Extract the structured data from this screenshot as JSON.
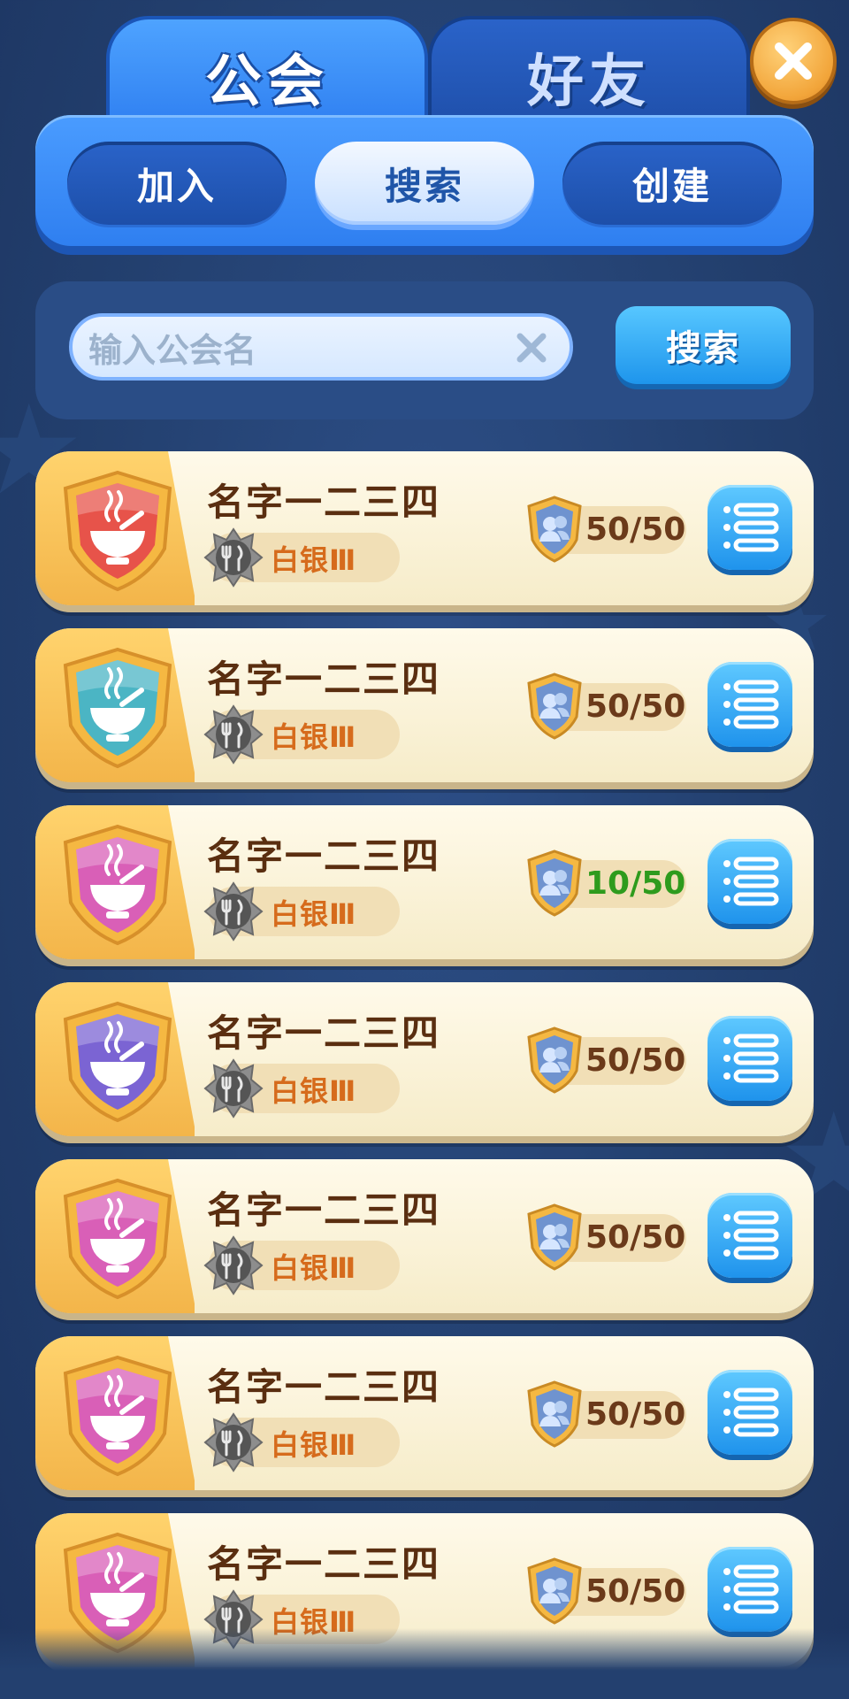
{
  "tabs": {
    "guild": "公会",
    "friends": "好友"
  },
  "close_icon": "close-x-icon",
  "sub_tabs": {
    "join": "加入",
    "search": "搜索",
    "create": "创建",
    "active": "search"
  },
  "search": {
    "placeholder": "输入公会名",
    "button": "搜索"
  },
  "guilds": [
    {
      "name": "名字一二三四",
      "rank": "白银Ⅲ",
      "members": "50/50",
      "color": "#e7534a",
      "full": true
    },
    {
      "name": "名字一二三四",
      "rank": "白银Ⅲ",
      "members": "50/50",
      "color": "#4bb5c4",
      "full": true
    },
    {
      "name": "名字一二三四",
      "rank": "白银Ⅲ",
      "members": "10/50",
      "color": "#d95fb7",
      "full": false
    },
    {
      "name": "名字一二三四",
      "rank": "白银Ⅲ",
      "members": "50/50",
      "color": "#7b64d3",
      "full": true
    },
    {
      "name": "名字一二三四",
      "rank": "白银Ⅲ",
      "members": "50/50",
      "color": "#d95fb7",
      "full": true
    },
    {
      "name": "名字一二三四",
      "rank": "白银Ⅲ",
      "members": "50/50",
      "color": "#d95fb7",
      "full": true
    },
    {
      "name": "名字一二三四",
      "rank": "白银Ⅲ",
      "members": "50/50",
      "color": "#d95fb7",
      "full": true
    }
  ],
  "colors": {
    "accent": "#2f7ff0",
    "card": "#fdf6dc",
    "gold": "#f3b54a",
    "green_count": "#2e9b1d"
  }
}
